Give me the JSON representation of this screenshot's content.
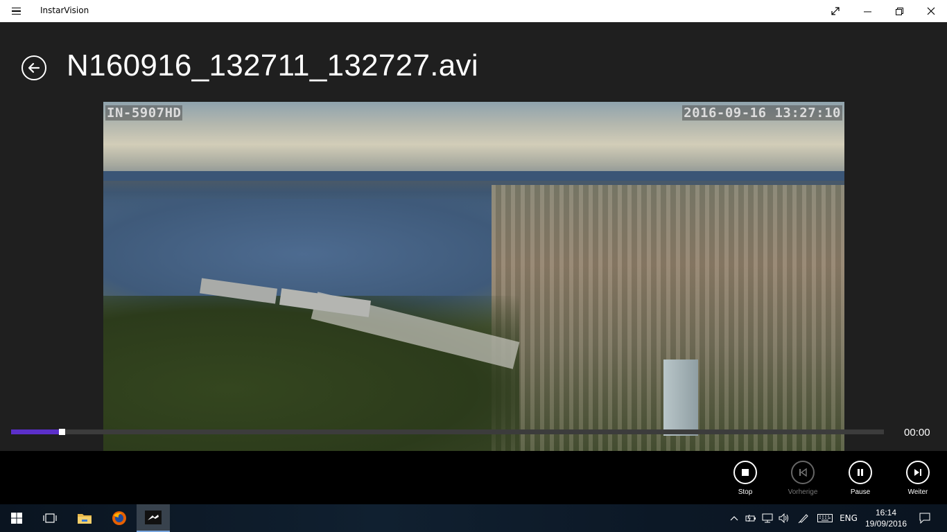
{
  "app": {
    "title": "InstarVision"
  },
  "page": {
    "file_title": "N160916_132711_132727.avi"
  },
  "video": {
    "camera_label": "IN-5907HD",
    "timestamp": "2016-09-16 13:27:10"
  },
  "playback": {
    "progress_fraction": 0.055,
    "time_label": "00:00",
    "accent_color": "#5b2fc9"
  },
  "controls": {
    "stop_label": "Stop",
    "previous_label": "Vorherige",
    "pause_label": "Pause",
    "next_label": "Weiter"
  },
  "taskbar": {
    "language": "ENG",
    "time": "16:14",
    "date": "19/09/2016",
    "apps": [
      "start-icon",
      "task-view-icon",
      "file-explorer-icon",
      "firefox-icon",
      "instarvision-icon"
    ]
  }
}
